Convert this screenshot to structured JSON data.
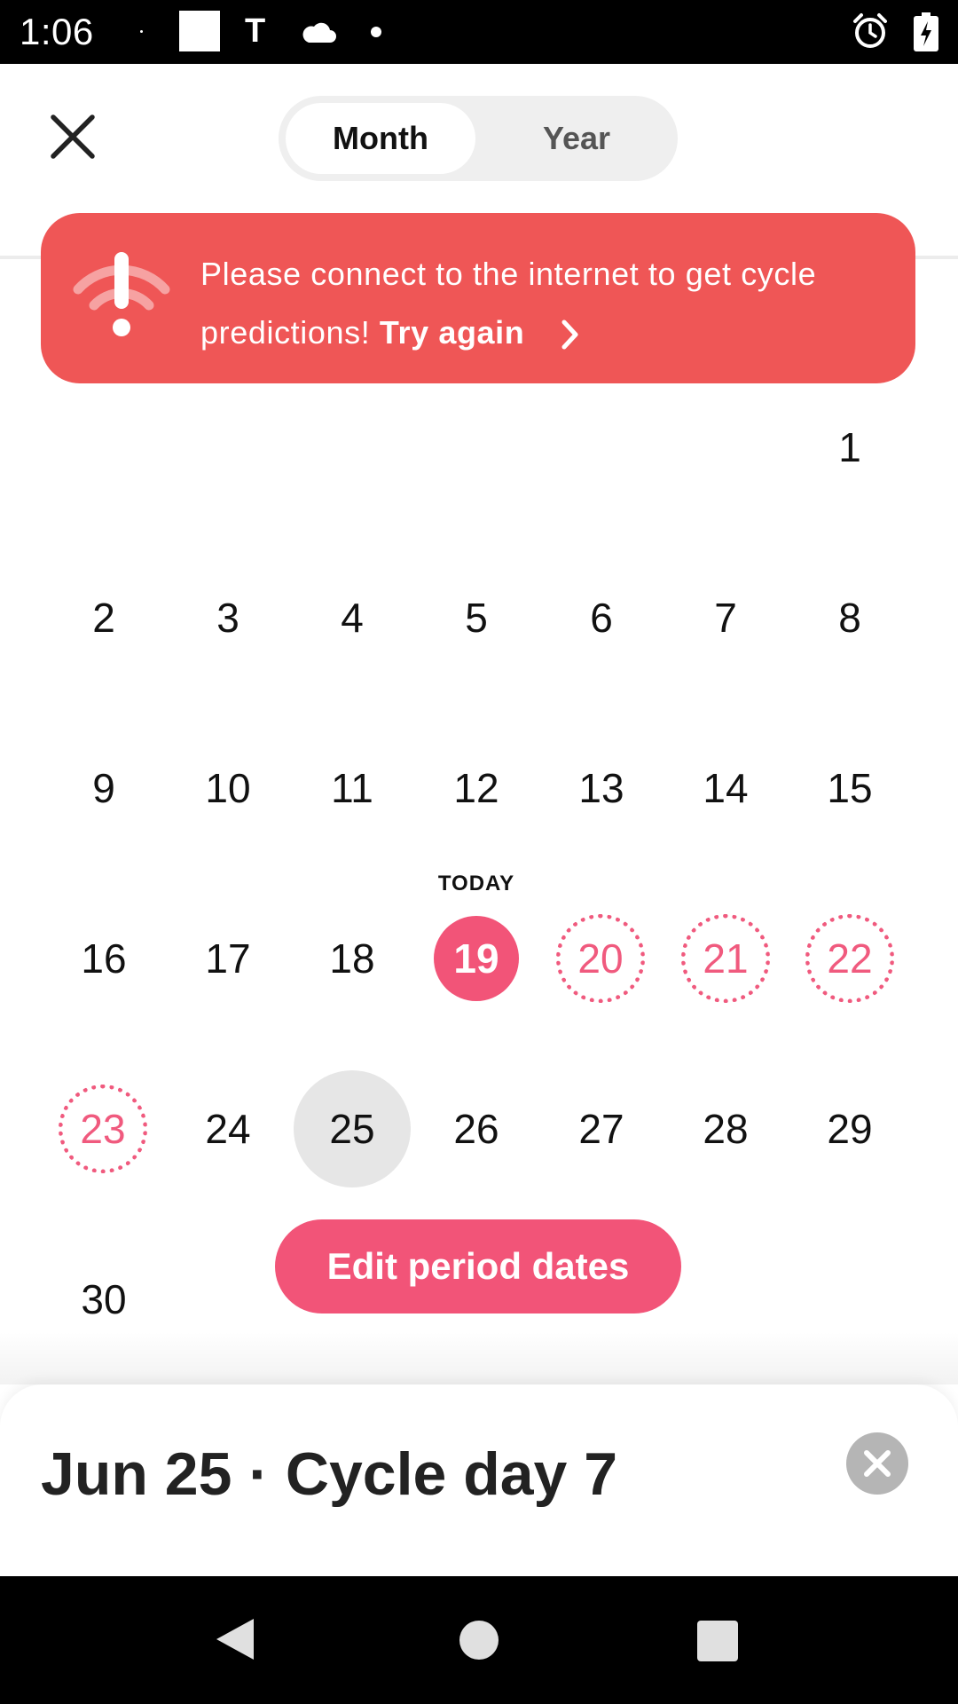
{
  "status_bar": {
    "time": "1:06",
    "notification_letter": "T",
    "icons": [
      "square-icon",
      "t-icon",
      "cloud-icon",
      "dot-icon",
      "alarm-icon",
      "battery-charging-icon"
    ]
  },
  "header": {
    "close_icon": "close-icon",
    "tabs": [
      {
        "label": "Month",
        "selected": true
      },
      {
        "label": "Year",
        "selected": false
      }
    ]
  },
  "banner": {
    "icon": "wifi-alert-icon",
    "message": "Please connect to the internet to get cycle predictions!",
    "action_label": "Try again",
    "action_icon": "chevron-right-icon",
    "color": "#ef5656"
  },
  "calendar": {
    "today_label": "TODAY",
    "today": "19",
    "selected": "25",
    "days": [
      "1",
      "2",
      "3",
      "4",
      "5",
      "6",
      "7",
      "8",
      "9",
      "10",
      "11",
      "12",
      "13",
      "14",
      "15",
      "16",
      "17",
      "18",
      "19",
      "20",
      "21",
      "22",
      "23",
      "24",
      "25",
      "26",
      "27",
      "28",
      "29",
      "30"
    ],
    "predicted_days": [
      "20",
      "21",
      "22",
      "23"
    ],
    "accent_color": "#f25478"
  },
  "edit_button": {
    "label": "Edit period dates"
  },
  "sheet": {
    "title": "Jun 25 · Cycle day 7",
    "close_icon": "close-circle-icon"
  },
  "nav_bar": {
    "icons": [
      "back-icon",
      "home-icon",
      "recents-icon"
    ]
  }
}
